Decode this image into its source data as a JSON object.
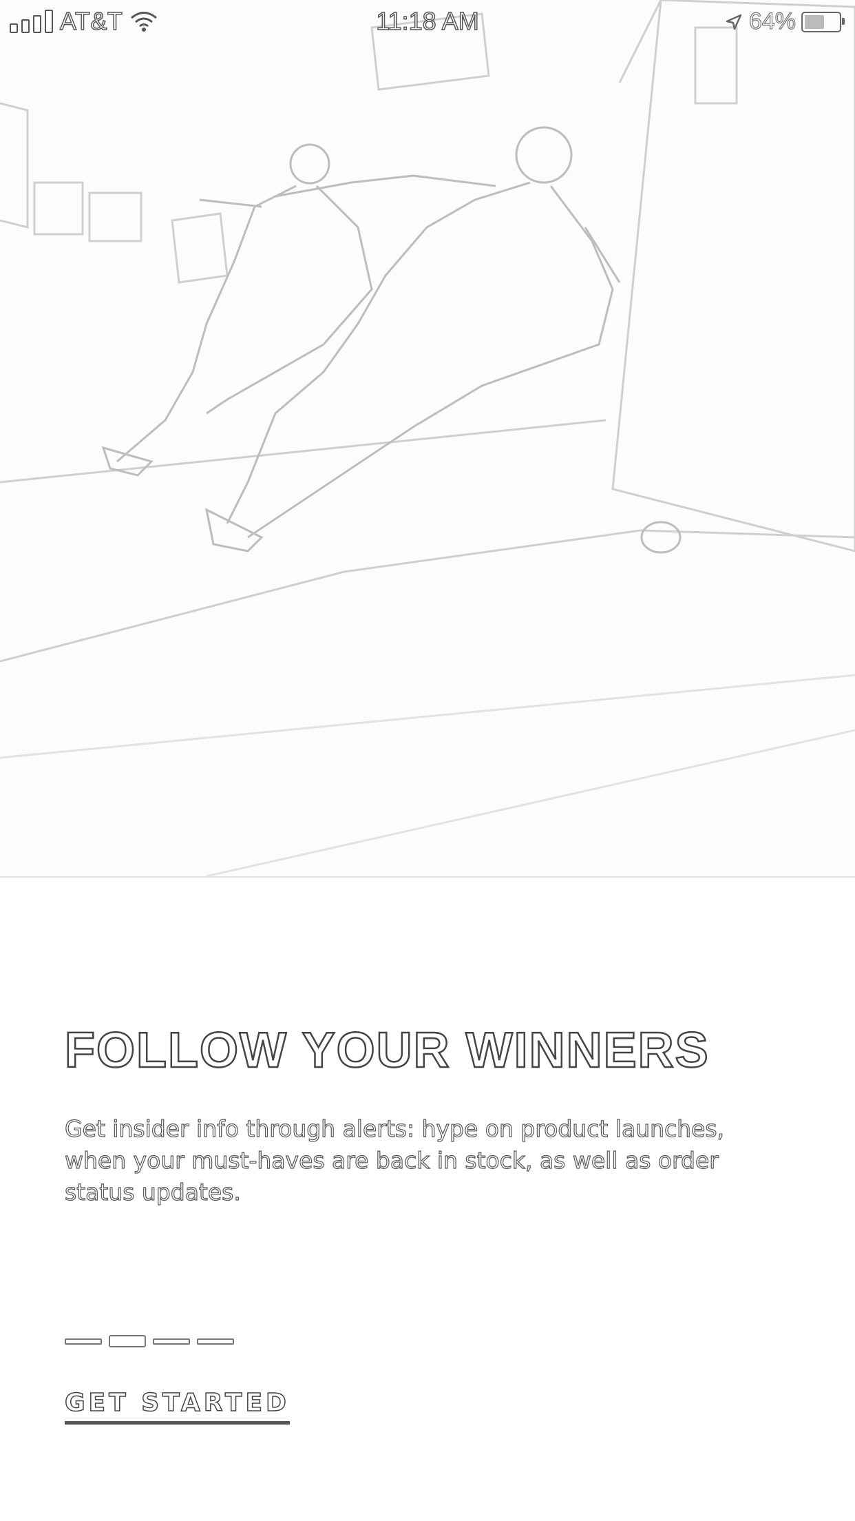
{
  "status_bar": {
    "carrier": "AT&T",
    "time": "11:18 AM",
    "battery_percent": "64%",
    "battery_level": 0.64,
    "icons": [
      "signal-icon",
      "wifi-icon",
      "location-icon",
      "battery-icon"
    ]
  },
  "onboarding": {
    "headline": "FOLLOW YOUR WINNERS",
    "description": "Get insider info through alerts: hype on product launches, when your must-haves are back in stock, as well as order status updates.",
    "pager": {
      "total_pages": 4,
      "current_page": 2
    },
    "cta_label": "GET STARTED"
  }
}
